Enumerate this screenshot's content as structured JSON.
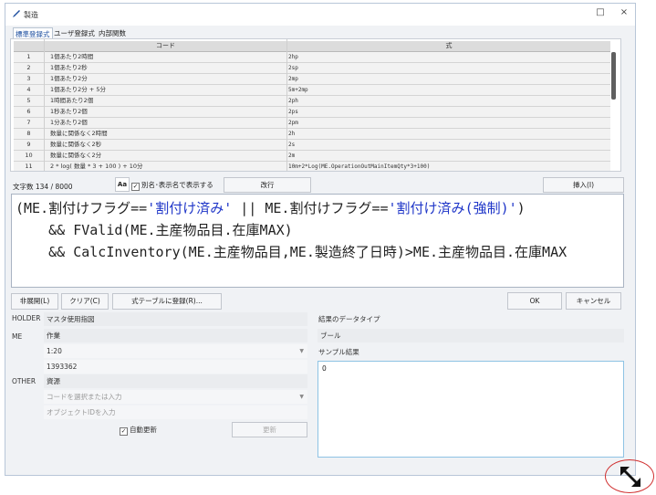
{
  "window": {
    "title": "製造",
    "minimize": "□",
    "close": "×"
  },
  "tabs": [
    "標準登録式",
    "ユーザ登録式",
    "内部関数"
  ],
  "grid": {
    "col_code": "コード",
    "col_expr": "式",
    "rows": [
      {
        "n": "1",
        "code": "1個あたり2時間",
        "expr": "2hp"
      },
      {
        "n": "2",
        "code": "1個あたり2秒",
        "expr": "2sp"
      },
      {
        "n": "3",
        "code": "1個あたり2分",
        "expr": "2mp"
      },
      {
        "n": "4",
        "code": "1個あたり2分 + 5分",
        "expr": "5m+2mp"
      },
      {
        "n": "5",
        "code": "1時間あたり2個",
        "expr": "2ph"
      },
      {
        "n": "6",
        "code": "1秒あたり2個",
        "expr": "2ps"
      },
      {
        "n": "7",
        "code": "1分あたり2個",
        "expr": "2pm"
      },
      {
        "n": "8",
        "code": "数量に関係なく2時間",
        "expr": "2h"
      },
      {
        "n": "9",
        "code": "数量に関係なく2秒",
        "expr": "2s"
      },
      {
        "n": "10",
        "code": "数量に関係なく2分",
        "expr": "2m"
      },
      {
        "n": "11",
        "code": "2 * log( 数量 * 3 + 100 ) + 10分",
        "expr": "10m+2*Log(ME.OperationOutMainItemQty*3+100)"
      }
    ]
  },
  "toolbar": {
    "char_count": "文字数 134 / 8000",
    "aa": "Aa",
    "alias_check": "✓",
    "alias_label": "別名･表示名で表示する",
    "newline": "改行",
    "insert": "挿入(I)"
  },
  "editor": {
    "l1a": "(ME.割付けフラグ==",
    "l1b": "'割付け済み'",
    "l1c": " || ME.割付けフラグ==",
    "l1d": "'割付け済み(強制)'",
    "l1e": ")",
    "l2": "    && FValid(ME.主産物品目.在庫MAX)",
    "l3": "    && CalcInventory(ME.主産物品目,ME.製造終了日時)>ME.主産物品目.在庫MAX"
  },
  "buttons": {
    "collapse": "非展開(L)",
    "clear": "クリア(C)",
    "register": "式テーブルに登録(R)...",
    "ok": "OK",
    "cancel": "キャンセル",
    "update": "更新"
  },
  "params": {
    "holder_label": "HOLDER",
    "holder_value": "マスタ使用指図",
    "me_label": "ME",
    "me_value": "作業",
    "me_combo": "1:20",
    "me_id": "1393362",
    "other_label": "OTHER",
    "other_value": "資源",
    "other_combo_placeholder": "コードを選択または入力",
    "other_id_placeholder": "オブジェクトIDを入力",
    "auto_check": "✓",
    "auto_label": "自動更新"
  },
  "result": {
    "type_label": "結果のデータタイプ",
    "type_value": "ブール",
    "sample_label": "サンプル結果",
    "sample_value": "0"
  },
  "colors": {
    "accent": "#1d4fa0",
    "string": "#1e35c8",
    "highlight": "#d03030"
  }
}
